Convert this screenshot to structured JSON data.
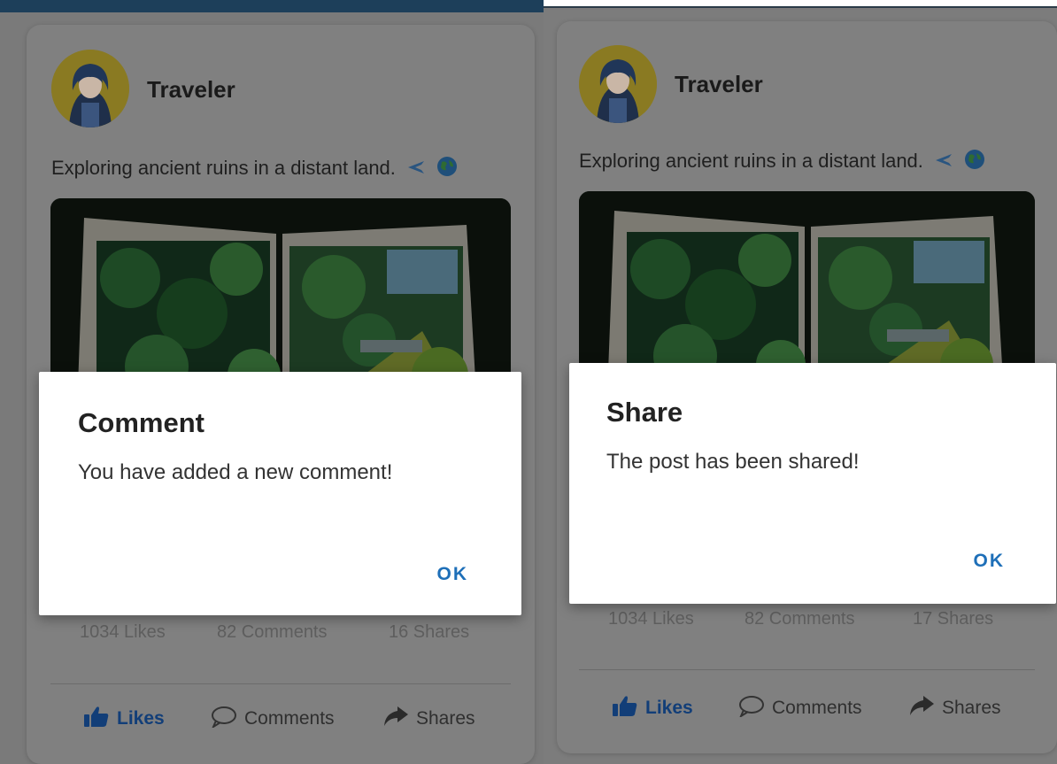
{
  "posts": [
    {
      "user_name": "Traveler",
      "post_text": "Exploring ancient ruins in a distant land.",
      "stats": {
        "likes": "1034 Likes",
        "comments": "82 Comments",
        "shares": "16 Shares"
      },
      "actions": {
        "likes": "Likes",
        "comments": "Comments",
        "shares": "Shares"
      },
      "dialog": {
        "title": "Comment",
        "message": "You have added a new comment!",
        "ok_label": "OK"
      }
    },
    {
      "user_name": "Traveler",
      "post_text": "Exploring ancient ruins in a distant land.",
      "stats": {
        "likes": "1034 Likes",
        "comments": "82 Comments",
        "shares": "17 Shares"
      },
      "actions": {
        "likes": "Likes",
        "comments": "Comments",
        "shares": "Shares"
      },
      "dialog": {
        "title": "Share",
        "message": "The post has been shared!",
        "ok_label": "OK"
      }
    }
  ],
  "icons": [
    "airplane-icon",
    "globe-icon",
    "thumbs-up-icon",
    "comment-bubble-icon",
    "share-arrow-icon"
  ],
  "colors": {
    "accent": "#1e6fb8",
    "likes_active": "#123e78",
    "scrim": "#7a7a7a"
  }
}
